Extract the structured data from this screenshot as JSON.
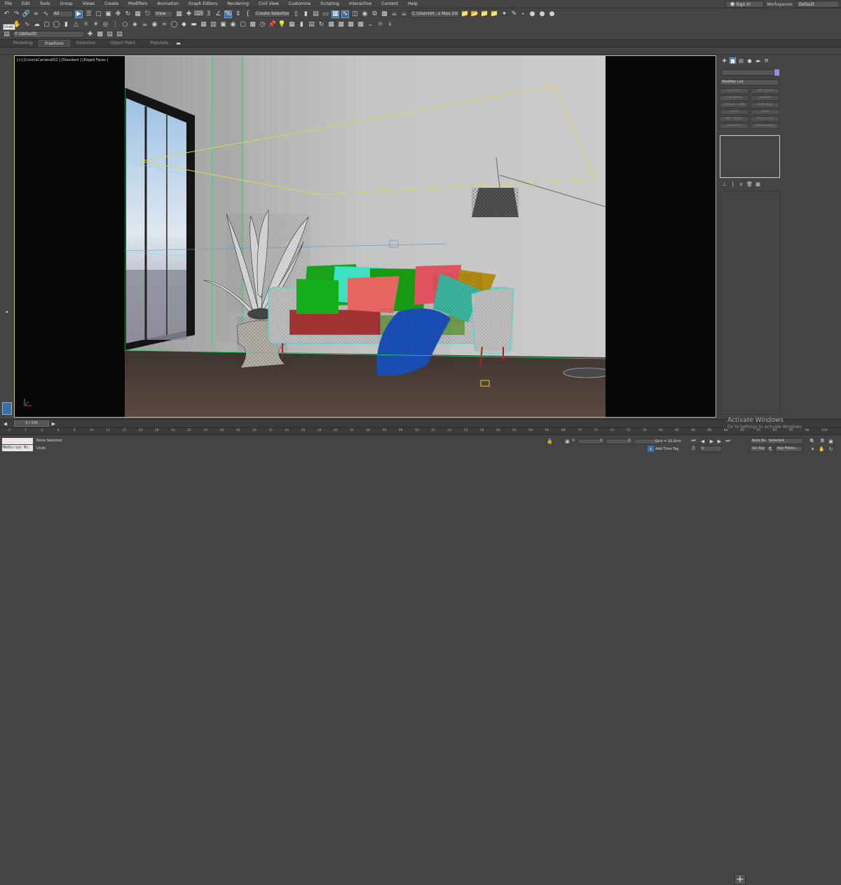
{
  "menu": [
    "File",
    "Edit",
    "Tools",
    "Group",
    "Views",
    "Create",
    "Modifiers",
    "Animation",
    "Graph Editors",
    "Rendering",
    "Civil View",
    "Customize",
    "Scripting",
    "Interactive",
    "Content",
    "Help"
  ],
  "signin": "Sign In",
  "workspaces_label": "Workspaces:",
  "workspace_value": "Default",
  "toolbar1": {
    "selection_filter": "All",
    "reference_coord": "View",
    "named_selection": "Create Selection Se",
    "path": "C:\\Users\\H...s Max 2020"
  },
  "layer": {
    "value": "0 (default)"
  },
  "undo_tooltip": "Undo",
  "ribbon_tabs": [
    "Modeling",
    "Freeform",
    "Selection",
    "Object Paint",
    "Populate"
  ],
  "viewport_label": "[+] [CoronaCamera002 ] [Standard ] [Edged Faces ]",
  "command_panel": {
    "modifier_list": "Modifier List",
    "modifiers": [
      "Edit Poly",
      "Edit Spline",
      "FFD 4x4x4",
      "Extrude",
      "Unwrap UVW",
      "UVW Map",
      "Lathe",
      "Shell",
      "Mtl. Assign",
      "FFD 3x3x3",
      "Symmetry",
      "Turbosmooth"
    ]
  },
  "timeline": {
    "frame_text": "0 / 100",
    "ticks": [
      "0",
      "2",
      "4",
      "6",
      "8",
      "10",
      "12",
      "14",
      "16",
      "18",
      "20",
      "22",
      "24",
      "26",
      "28",
      "30",
      "32",
      "34",
      "36",
      "38",
      "40",
      "42",
      "44",
      "46",
      "48",
      "50",
      "52",
      "54",
      "56",
      "58",
      "60",
      "62",
      "64",
      "66",
      "68",
      "70",
      "72",
      "74",
      "76",
      "78",
      "80",
      "82",
      "84",
      "86",
      "88",
      "90",
      "92",
      "94",
      "96",
      "98",
      "100"
    ]
  },
  "status": {
    "maxscript": "MAXScript Mi:",
    "selection": "None Selected",
    "prompt": "Undo",
    "x_label": "X:",
    "y_label": "Y:",
    "z_label": "Z:",
    "grid": "Grid = 10.0cm",
    "add_time_tag": "Add Time Tag",
    "auto_key": "Auto Key",
    "set_key": "Set Key",
    "selected": "Selected",
    "key_filters": "Key Filters...",
    "frame": "0"
  },
  "watermark": {
    "title": "Activate Windows",
    "sub": "Go to Settings to activate Windows."
  }
}
